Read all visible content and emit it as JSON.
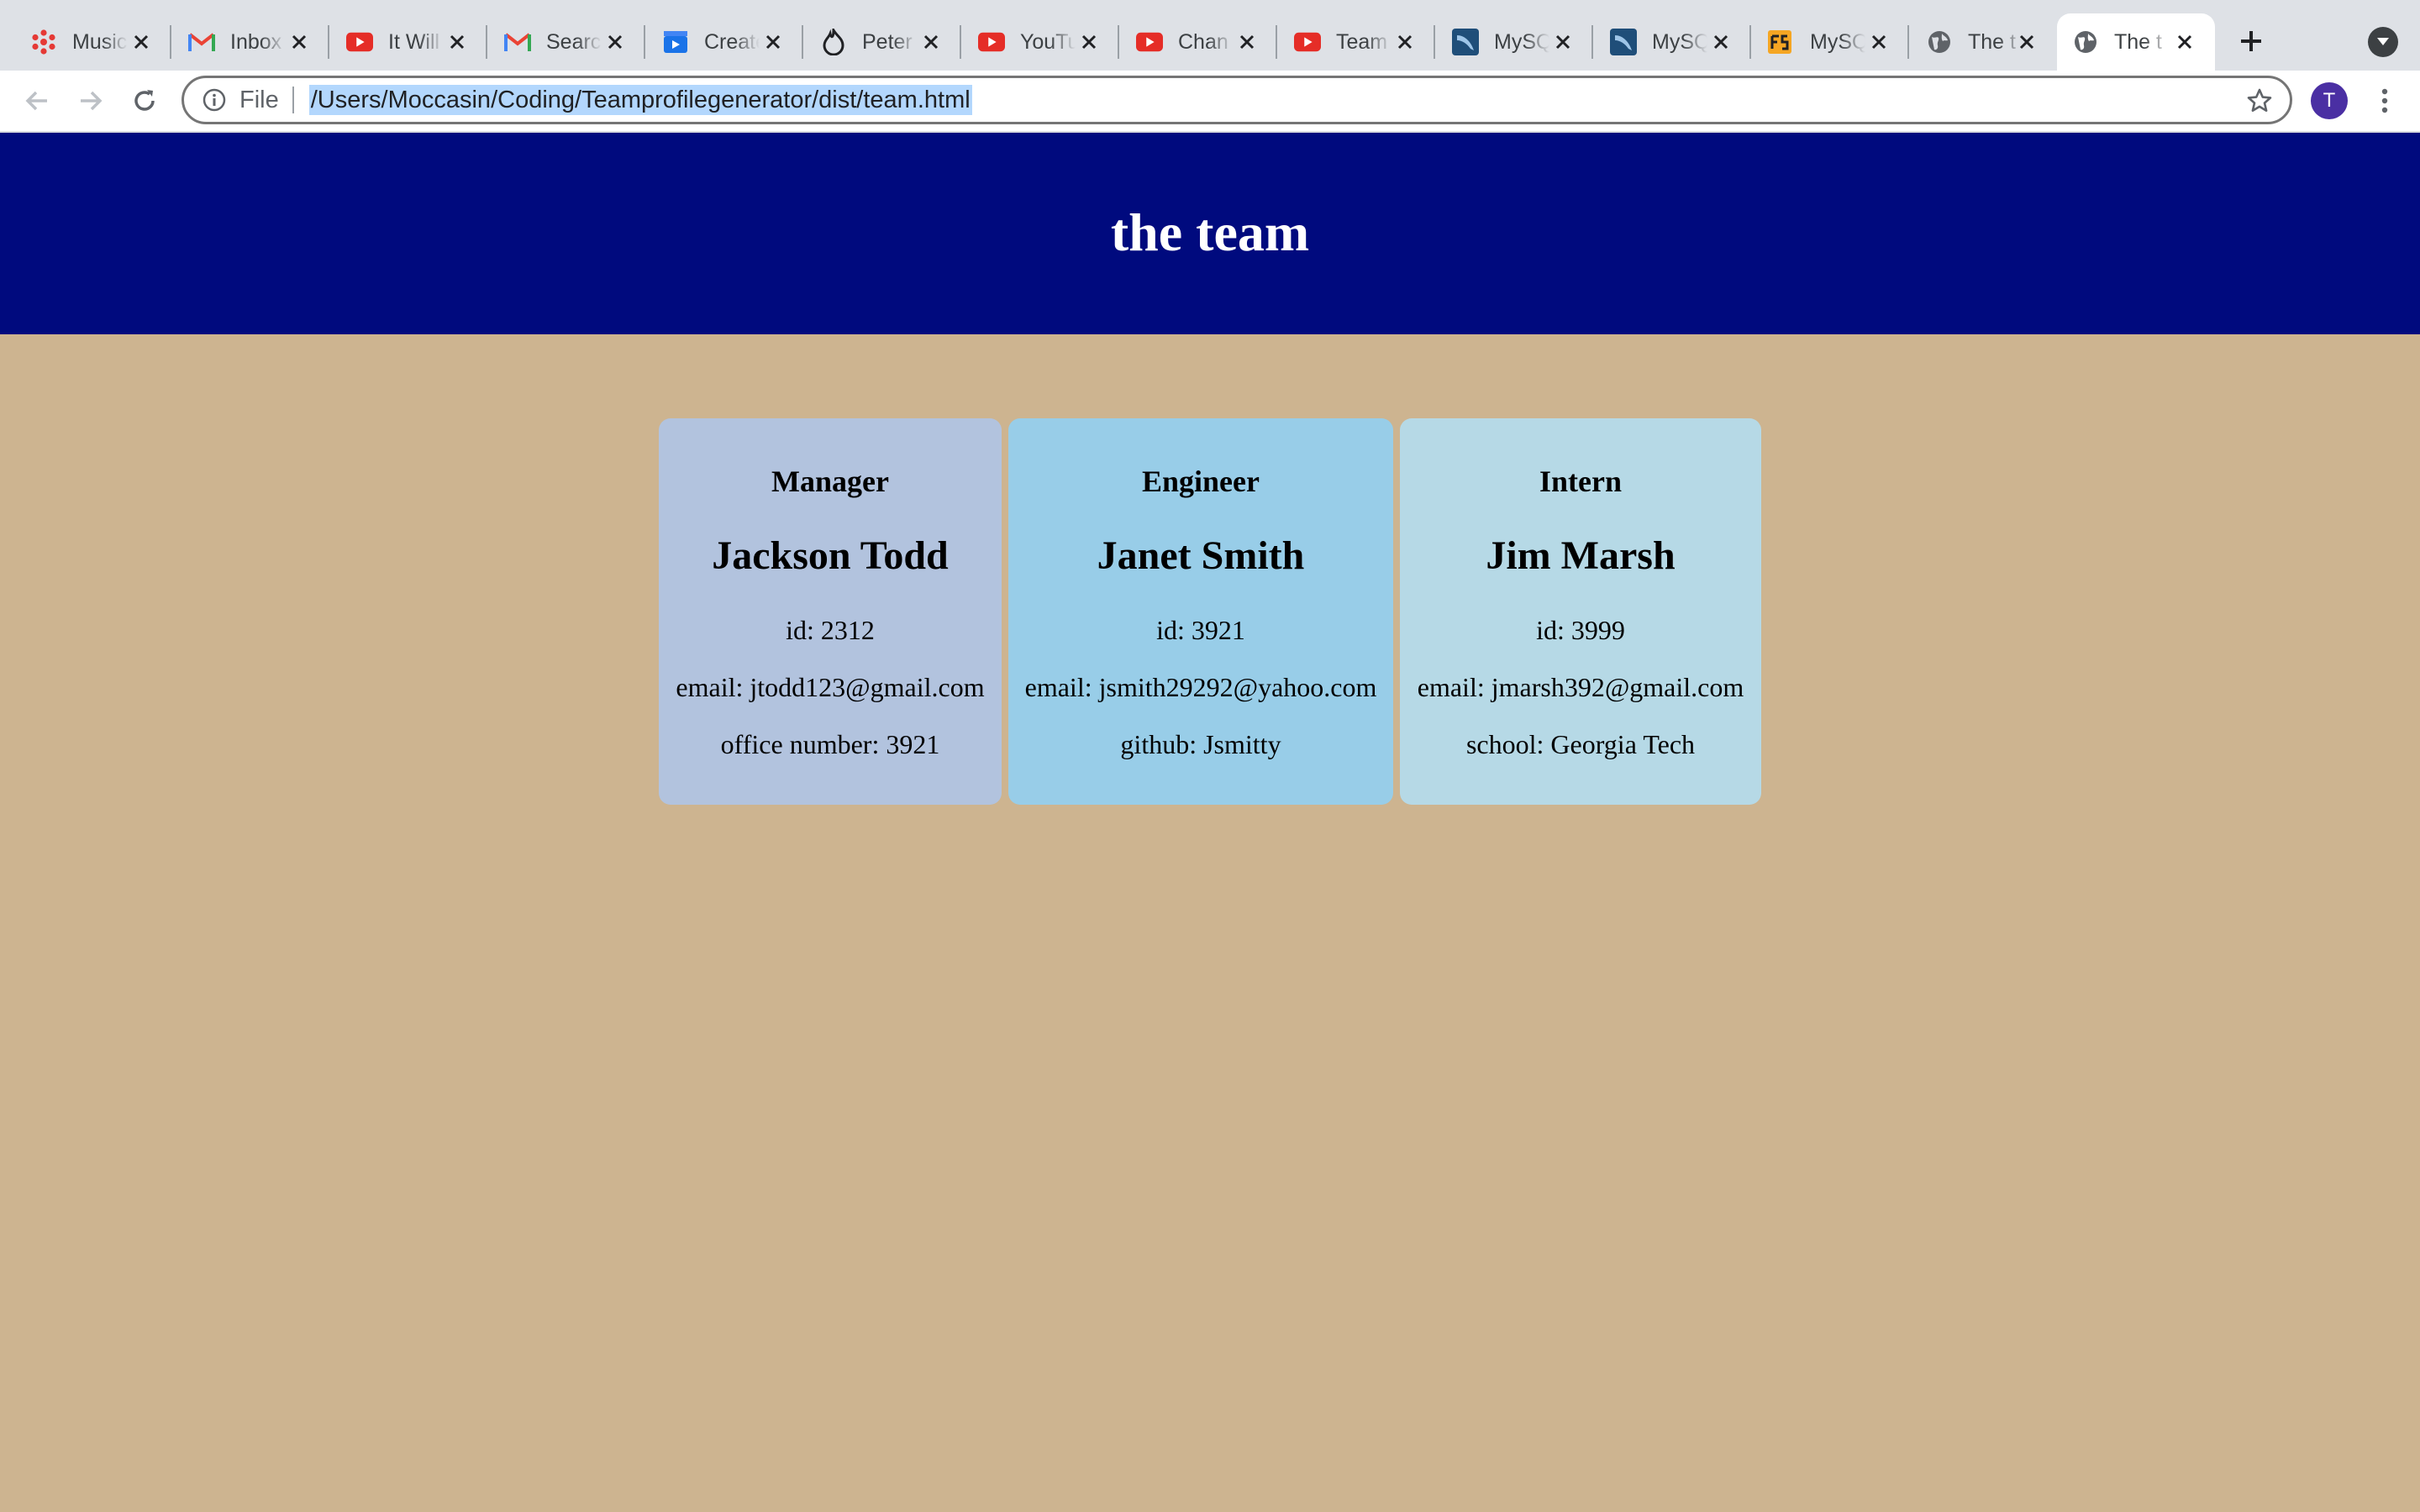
{
  "browser": {
    "tabs": [
      {
        "title": "Music",
        "icon": "music-asterisk-icon"
      },
      {
        "title": "Inbox",
        "icon": "gmail-icon"
      },
      {
        "title": "It Will",
        "icon": "youtube-icon"
      },
      {
        "title": "Search",
        "icon": "gmail-icon"
      },
      {
        "title": "Create",
        "icon": "clapperboard-icon"
      },
      {
        "title": "Peter",
        "icon": "flame-icon"
      },
      {
        "title": "YouTube",
        "icon": "youtube-icon"
      },
      {
        "title": "Chan",
        "icon": "youtube-icon"
      },
      {
        "title": "Team",
        "icon": "youtube-icon"
      },
      {
        "title": "MySQL",
        "icon": "mysql-dolphin-icon"
      },
      {
        "title": "MySQL",
        "icon": "mysql-dolphin-icon"
      },
      {
        "title": "MySQL",
        "icon": "fs-icon"
      },
      {
        "title": "The t",
        "icon": "globe-icon"
      },
      {
        "title": "The t",
        "icon": "globe-icon",
        "active": true
      }
    ],
    "omnibox": {
      "scheme_label": "File",
      "url": "/Users/Moccasin/Coding/Teamprofilegenerator/dist/team.html"
    },
    "profile_initial": "T"
  },
  "page": {
    "header_title": "the team",
    "cards": [
      {
        "role": "Manager",
        "name": "Jackson Todd",
        "id_line": "id: 2312",
        "email_line": "email: jtodd123@gmail.com",
        "extra_line": "office number: 3921",
        "bg": "#b2c3de"
      },
      {
        "role": "Engineer",
        "name": "Janet Smith",
        "id_line": "id: 3921",
        "email_line": "email: jsmith29292@yahoo.com",
        "extra_line": "github: Jsmitty",
        "bg": "#98cde8"
      },
      {
        "role": "Intern",
        "name": "Jim Marsh",
        "id_line": "id: 3999",
        "email_line": "email: jmarsh392@gmail.com",
        "extra_line": "school: Georgia Tech",
        "bg": "#b6d9e6"
      }
    ]
  },
  "colors": {
    "page_bg": "#cdb490",
    "header_bg": "#000a7e",
    "tabstrip_bg": "#dee1e6"
  }
}
